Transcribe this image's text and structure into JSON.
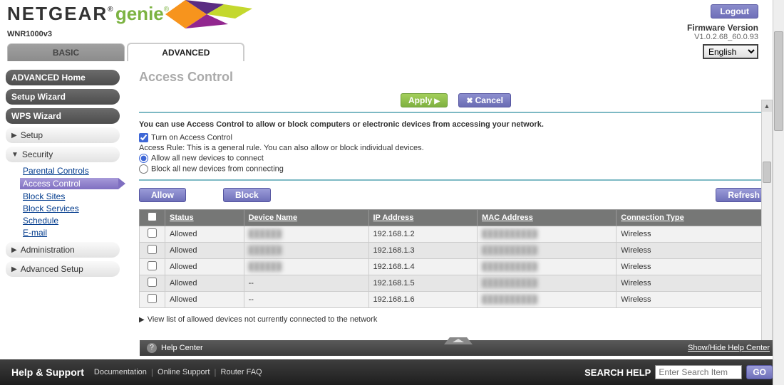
{
  "brand": {
    "line1": "NETGEAR",
    "line2": "genie",
    "model": "WNR1000v3"
  },
  "header": {
    "logout": "Logout",
    "firmware_label": "Firmware Version",
    "firmware_value": "V1.0.2.68_60.0.93",
    "language": "English"
  },
  "tabs": {
    "basic": "BASIC",
    "advanced": "ADVANCED"
  },
  "sidebar": {
    "home": "ADVANCED Home",
    "wizard": "Setup Wizard",
    "wps": "WPS Wizard",
    "setup": "Setup",
    "security": "Security",
    "security_items": {
      "parental": "Parental Controls",
      "access": "Access Control",
      "block_sites": "Block Sites",
      "block_services": "Block Services",
      "schedule": "Schedule",
      "email": "E-mail"
    },
    "admin": "Administration",
    "adv_setup": "Advanced Setup"
  },
  "page": {
    "title": "Access Control",
    "apply": "Apply",
    "cancel": "Cancel",
    "instruction": "You can use Access Control to allow or block computers or electronic devices from accessing your network.",
    "turn_on": "Turn on Access Control",
    "rule_text": "Access Rule: This is a general rule. You can also allow or block individual devices.",
    "opt_allow": "Allow all new devices to connect",
    "opt_block": "Block all new devices from connecting",
    "btn_allow": "Allow",
    "btn_block": "Block",
    "btn_refresh": "Refresh",
    "view_list": "View list of allowed devices not currently connected to the network",
    "columns": {
      "status": "Status",
      "device": "Device Name",
      "ip": "IP Address",
      "mac": "MAC Address",
      "conn": "Connection Type"
    },
    "rows": [
      {
        "status": "Allowed",
        "device": " ",
        "ip": "192.168.1.2",
        "mac": " ",
        "conn": "Wireless"
      },
      {
        "status": "Allowed",
        "device": " ",
        "ip": "192.168.1.3",
        "mac": " ",
        "conn": "Wireless"
      },
      {
        "status": "Allowed",
        "device": " ",
        "ip": "192.168.1.4",
        "mac": " ",
        "conn": "Wireless"
      },
      {
        "status": "Allowed",
        "device": "--",
        "ip": "192.168.1.5",
        "mac": " ",
        "conn": "Wireless"
      },
      {
        "status": "Allowed",
        "device": "--",
        "ip": "192.168.1.6",
        "mac": " ",
        "conn": "Wireless"
      }
    ]
  },
  "helpbar": {
    "label": "Help Center",
    "toggle": "Show/Hide Help Center"
  },
  "footer": {
    "title": "Help & Support",
    "doc": "Documentation",
    "online": "Online Support",
    "faq": "Router FAQ",
    "search_label": "SEARCH HELP",
    "search_placeholder": "Enter Search Item",
    "go": "GO"
  }
}
